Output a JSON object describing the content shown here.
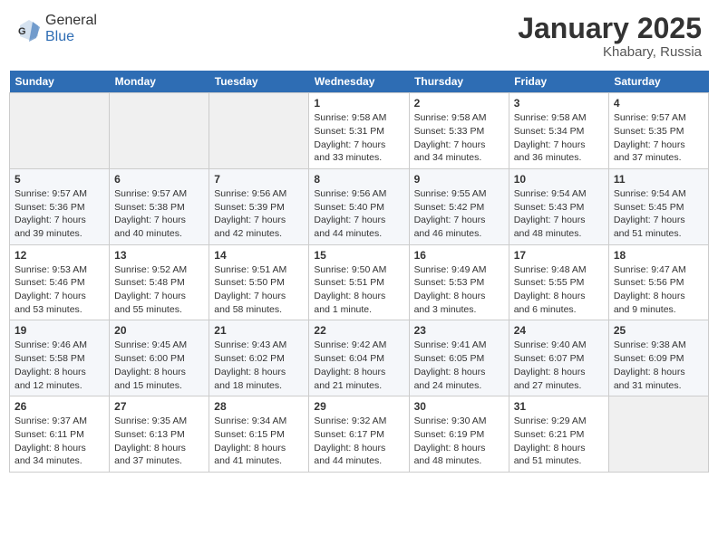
{
  "header": {
    "logo_general": "General",
    "logo_blue": "Blue",
    "month_title": "January 2025",
    "location": "Khabary, Russia"
  },
  "weekdays": [
    "Sunday",
    "Monday",
    "Tuesday",
    "Wednesday",
    "Thursday",
    "Friday",
    "Saturday"
  ],
  "weeks": [
    [
      {
        "day": "",
        "sunrise": "",
        "sunset": "",
        "daylight": ""
      },
      {
        "day": "",
        "sunrise": "",
        "sunset": "",
        "daylight": ""
      },
      {
        "day": "",
        "sunrise": "",
        "sunset": "",
        "daylight": ""
      },
      {
        "day": "1",
        "sunrise": "Sunrise: 9:58 AM",
        "sunset": "Sunset: 5:31 PM",
        "daylight": "Daylight: 7 hours and 33 minutes."
      },
      {
        "day": "2",
        "sunrise": "Sunrise: 9:58 AM",
        "sunset": "Sunset: 5:33 PM",
        "daylight": "Daylight: 7 hours and 34 minutes."
      },
      {
        "day": "3",
        "sunrise": "Sunrise: 9:58 AM",
        "sunset": "Sunset: 5:34 PM",
        "daylight": "Daylight: 7 hours and 36 minutes."
      },
      {
        "day": "4",
        "sunrise": "Sunrise: 9:57 AM",
        "sunset": "Sunset: 5:35 PM",
        "daylight": "Daylight: 7 hours and 37 minutes."
      }
    ],
    [
      {
        "day": "5",
        "sunrise": "Sunrise: 9:57 AM",
        "sunset": "Sunset: 5:36 PM",
        "daylight": "Daylight: 7 hours and 39 minutes."
      },
      {
        "day": "6",
        "sunrise": "Sunrise: 9:57 AM",
        "sunset": "Sunset: 5:38 PM",
        "daylight": "Daylight: 7 hours and 40 minutes."
      },
      {
        "day": "7",
        "sunrise": "Sunrise: 9:56 AM",
        "sunset": "Sunset: 5:39 PM",
        "daylight": "Daylight: 7 hours and 42 minutes."
      },
      {
        "day": "8",
        "sunrise": "Sunrise: 9:56 AM",
        "sunset": "Sunset: 5:40 PM",
        "daylight": "Daylight: 7 hours and 44 minutes."
      },
      {
        "day": "9",
        "sunrise": "Sunrise: 9:55 AM",
        "sunset": "Sunset: 5:42 PM",
        "daylight": "Daylight: 7 hours and 46 minutes."
      },
      {
        "day": "10",
        "sunrise": "Sunrise: 9:54 AM",
        "sunset": "Sunset: 5:43 PM",
        "daylight": "Daylight: 7 hours and 48 minutes."
      },
      {
        "day": "11",
        "sunrise": "Sunrise: 9:54 AM",
        "sunset": "Sunset: 5:45 PM",
        "daylight": "Daylight: 7 hours and 51 minutes."
      }
    ],
    [
      {
        "day": "12",
        "sunrise": "Sunrise: 9:53 AM",
        "sunset": "Sunset: 5:46 PM",
        "daylight": "Daylight: 7 hours and 53 minutes."
      },
      {
        "day": "13",
        "sunrise": "Sunrise: 9:52 AM",
        "sunset": "Sunset: 5:48 PM",
        "daylight": "Daylight: 7 hours and 55 minutes."
      },
      {
        "day": "14",
        "sunrise": "Sunrise: 9:51 AM",
        "sunset": "Sunset: 5:50 PM",
        "daylight": "Daylight: 7 hours and 58 minutes."
      },
      {
        "day": "15",
        "sunrise": "Sunrise: 9:50 AM",
        "sunset": "Sunset: 5:51 PM",
        "daylight": "Daylight: 8 hours and 1 minute."
      },
      {
        "day": "16",
        "sunrise": "Sunrise: 9:49 AM",
        "sunset": "Sunset: 5:53 PM",
        "daylight": "Daylight: 8 hours and 3 minutes."
      },
      {
        "day": "17",
        "sunrise": "Sunrise: 9:48 AM",
        "sunset": "Sunset: 5:55 PM",
        "daylight": "Daylight: 8 hours and 6 minutes."
      },
      {
        "day": "18",
        "sunrise": "Sunrise: 9:47 AM",
        "sunset": "Sunset: 5:56 PM",
        "daylight": "Daylight: 8 hours and 9 minutes."
      }
    ],
    [
      {
        "day": "19",
        "sunrise": "Sunrise: 9:46 AM",
        "sunset": "Sunset: 5:58 PM",
        "daylight": "Daylight: 8 hours and 12 minutes."
      },
      {
        "day": "20",
        "sunrise": "Sunrise: 9:45 AM",
        "sunset": "Sunset: 6:00 PM",
        "daylight": "Daylight: 8 hours and 15 minutes."
      },
      {
        "day": "21",
        "sunrise": "Sunrise: 9:43 AM",
        "sunset": "Sunset: 6:02 PM",
        "daylight": "Daylight: 8 hours and 18 minutes."
      },
      {
        "day": "22",
        "sunrise": "Sunrise: 9:42 AM",
        "sunset": "Sunset: 6:04 PM",
        "daylight": "Daylight: 8 hours and 21 minutes."
      },
      {
        "day": "23",
        "sunrise": "Sunrise: 9:41 AM",
        "sunset": "Sunset: 6:05 PM",
        "daylight": "Daylight: 8 hours and 24 minutes."
      },
      {
        "day": "24",
        "sunrise": "Sunrise: 9:40 AM",
        "sunset": "Sunset: 6:07 PM",
        "daylight": "Daylight: 8 hours and 27 minutes."
      },
      {
        "day": "25",
        "sunrise": "Sunrise: 9:38 AM",
        "sunset": "Sunset: 6:09 PM",
        "daylight": "Daylight: 8 hours and 31 minutes."
      }
    ],
    [
      {
        "day": "26",
        "sunrise": "Sunrise: 9:37 AM",
        "sunset": "Sunset: 6:11 PM",
        "daylight": "Daylight: 8 hours and 34 minutes."
      },
      {
        "day": "27",
        "sunrise": "Sunrise: 9:35 AM",
        "sunset": "Sunset: 6:13 PM",
        "daylight": "Daylight: 8 hours and 37 minutes."
      },
      {
        "day": "28",
        "sunrise": "Sunrise: 9:34 AM",
        "sunset": "Sunset: 6:15 PM",
        "daylight": "Daylight: 8 hours and 41 minutes."
      },
      {
        "day": "29",
        "sunrise": "Sunrise: 9:32 AM",
        "sunset": "Sunset: 6:17 PM",
        "daylight": "Daylight: 8 hours and 44 minutes."
      },
      {
        "day": "30",
        "sunrise": "Sunrise: 9:30 AM",
        "sunset": "Sunset: 6:19 PM",
        "daylight": "Daylight: 8 hours and 48 minutes."
      },
      {
        "day": "31",
        "sunrise": "Sunrise: 9:29 AM",
        "sunset": "Sunset: 6:21 PM",
        "daylight": "Daylight: 8 hours and 51 minutes."
      },
      {
        "day": "",
        "sunrise": "",
        "sunset": "",
        "daylight": ""
      }
    ]
  ]
}
